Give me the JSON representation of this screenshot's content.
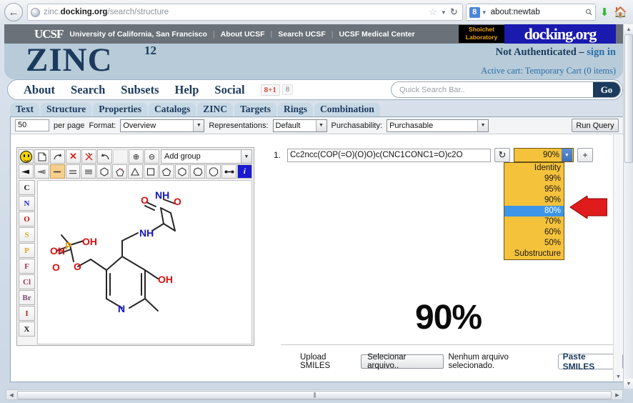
{
  "browser": {
    "back_icon": "back-arrow-icon",
    "url_prefix": "zinc.",
    "url_domain": "docking.org",
    "url_path": "/search/structure",
    "star_icon": "star-icon",
    "dropdown_icon": "chevron-down-icon",
    "reload_icon": "reload-icon",
    "search_engine": "g-badge",
    "search_value": "about:newtab",
    "search_icon": "magnifier-icon",
    "download_icon": "download-arrow-icon",
    "home_icon": "home-icon"
  },
  "ucsf_bar": {
    "logo": "UCSF",
    "title": "University of California, San Francisco",
    "links": [
      "About UCSF",
      "Search UCSF",
      "UCSF Medical Center"
    ],
    "shoichet_line1": "Shoichet",
    "shoichet_line2": "Laboratory",
    "docking_logo": "docking.org"
  },
  "zinc_header": {
    "logo": "ZINC",
    "superscript": "12",
    "auth_text": "Not Authenticated – ",
    "auth_link": "sign in",
    "cart_text": "Active cart: Temporary Cart (0 items)"
  },
  "main_nav": {
    "items": [
      "About",
      "Search",
      "Subsets",
      "Help",
      "Social"
    ],
    "gplus_label": "8+1",
    "gplus_count": "8",
    "search_placeholder": "Quick Search Bar..",
    "go_label": "Go"
  },
  "subtabs": [
    "Text",
    "Structure",
    "Properties",
    "Catalogs",
    "ZINC",
    "Targets",
    "Rings",
    "Combination"
  ],
  "query_bar": {
    "per_page_value": "50",
    "per_page_label": "per page",
    "format_label": "Format:",
    "format_value": "Overview",
    "representations_label": "Representations:",
    "representations_value": "Default",
    "purchasability_label": "Purchasability:",
    "purchasability_value": "Purchasable",
    "run_query_label": "Run Query"
  },
  "editor": {
    "toolbar_row1": [
      {
        "name": "smiley-icon",
        "glyph": ""
      },
      {
        "name": "new-file-icon",
        "glyph": "⬜"
      },
      {
        "name": "redo-curve-icon",
        "glyph": "↷"
      },
      {
        "name": "delete-x-icon",
        "glyph": "✕"
      },
      {
        "name": "erase-bond-icon",
        "glyph": "✄"
      },
      {
        "name": "undo-icon",
        "glyph": "↶"
      },
      {
        "name": "blank-icon",
        "glyph": ""
      },
      {
        "name": "zoom-in-icon",
        "glyph": "⊕"
      },
      {
        "name": "zoom-out-icon",
        "glyph": "⊖"
      }
    ],
    "add_group_value": "Add group",
    "toolbar_row2": [
      {
        "name": "wedge-bond-icon",
        "glyph": "◀"
      },
      {
        "name": "hash-bond-icon",
        "glyph": "◁"
      },
      {
        "name": "single-bond-icon",
        "glyph": "—"
      },
      {
        "name": "double-bond-icon",
        "glyph": "="
      },
      {
        "name": "triple-bond-icon",
        "glyph": "≡"
      },
      {
        "name": "hexagon-ring-icon",
        "glyph": "⬡"
      },
      {
        "name": "charge-ring-icon",
        "glyph": "⬠"
      },
      {
        "name": "triangle-ring-icon",
        "glyph": "△"
      },
      {
        "name": "square-ring-icon",
        "glyph": "□"
      },
      {
        "name": "pentagon-ring-icon",
        "glyph": "⬠"
      },
      {
        "name": "hexagon2-ring-icon",
        "glyph": "⬡"
      },
      {
        "name": "heptagon-ring-icon",
        "glyph": "⬡"
      },
      {
        "name": "octagon-ring-icon",
        "glyph": "⬡"
      },
      {
        "name": "dumbbell-icon",
        "glyph": "↔"
      },
      {
        "name": "info-icon",
        "glyph": "i"
      }
    ],
    "elements": [
      {
        "symbol": "C",
        "color": "#1a1a1a"
      },
      {
        "symbol": "N",
        "color": "#2222cc"
      },
      {
        "symbol": "O",
        "color": "#cc1111"
      },
      {
        "symbol": "S",
        "color": "#d6b12a"
      },
      {
        "symbol": "P",
        "color": "#e8a317"
      },
      {
        "symbol": "F",
        "color": "#9c3a5a"
      },
      {
        "symbol": "Cl",
        "color": "#9c3a5a"
      },
      {
        "symbol": "Br",
        "color": "#7a4a72"
      },
      {
        "symbol": "I",
        "color": "#b32020"
      },
      {
        "symbol": "X",
        "color": "#1a1a1a"
      }
    ],
    "molecule_labels": [
      "OH",
      "OH",
      "P",
      "O",
      "O",
      "NH",
      "O",
      "O",
      "NH",
      "OH",
      "N"
    ]
  },
  "query_row": {
    "index_label": "1.",
    "smiles_value": "Cc2ncc(COP(=O)(O)O)c(CNC1CONC1=O)c2O",
    "refresh_icon": "refresh-icon",
    "similarity_value": "90%",
    "add_label": "+"
  },
  "similarity_dropdown": {
    "options": [
      "Identity",
      "99%",
      "95%",
      "90%",
      "80%",
      "70%",
      "60%",
      "50%",
      "Substructure"
    ],
    "highlighted": "80%"
  },
  "big_display": {
    "value": "90%"
  },
  "annotation": {
    "arrow_name": "red-pointer-arrow",
    "arrow_color": "#e01b1b"
  },
  "upload": {
    "label": "Upload SMILES",
    "file_button": "Selecionar arquivo..",
    "file_status": "Nenhum arquivo selecionado.",
    "paste_button": "Paste SMILES"
  },
  "colors": {
    "ucsf_bar": "#6b7178",
    "zinc_blue": "#1b3a5c",
    "header_bg": "#b7cbd9",
    "dropdown_gold": "#f5c23c",
    "highlight_blue": "#3c95e8"
  }
}
